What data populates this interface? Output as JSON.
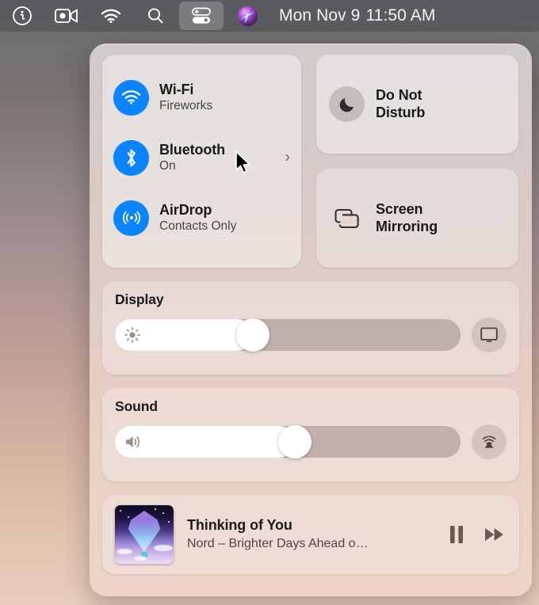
{
  "menubar": {
    "items": [
      {
        "name": "info-icon",
        "label": "Info"
      },
      {
        "name": "screen-record-icon",
        "label": "Screen Recording"
      },
      {
        "name": "wifi-icon",
        "label": "Wi-Fi"
      },
      {
        "name": "search-icon",
        "label": "Spotlight Search"
      },
      {
        "name": "control-center-icon",
        "label": "Control Center"
      },
      {
        "name": "siri-icon",
        "label": "Siri"
      }
    ],
    "clock": {
      "date": "Mon Nov 9",
      "time": "11:50 AM",
      "full": "Mon Nov 9  11:50 AM"
    }
  },
  "control_center": {
    "connectivity": {
      "rows": [
        {
          "icon": "wifi-icon",
          "title": "Wi-Fi",
          "subtitle": "Fireworks",
          "chevron": false
        },
        {
          "icon": "bluetooth-icon",
          "title": "Bluetooth",
          "subtitle": "On",
          "chevron": true,
          "chevron_glyph": "›"
        },
        {
          "icon": "airdrop-icon",
          "title": "AirDrop",
          "subtitle": "Contacts Only",
          "chevron": false
        }
      ],
      "accent_color": "#0a84ff"
    },
    "do_not_disturb": {
      "icon": "moon-icon",
      "line1": "Do Not",
      "line2": "Disturb"
    },
    "screen_mirroring": {
      "icon": "screen-mirroring-icon",
      "line1": "Screen",
      "line2": "Mirroring"
    },
    "display": {
      "label": "Display",
      "slider_glyph": "brightness-icon",
      "value_percent": 40,
      "side_button_icon": "display-icon"
    },
    "sound": {
      "label": "Sound",
      "slider_glyph": "volume-icon",
      "value_percent": 52,
      "side_button_icon": "airplay-icon"
    },
    "now_playing": {
      "artwork": "album-artwork",
      "title": "Thinking of You",
      "subtitle": "Nord – Brighter Days Ahead o…",
      "pause_icon": "pause-icon",
      "forward_icon": "fast-forward-icon"
    }
  },
  "cursor": {
    "name": "mouse-pointer"
  }
}
